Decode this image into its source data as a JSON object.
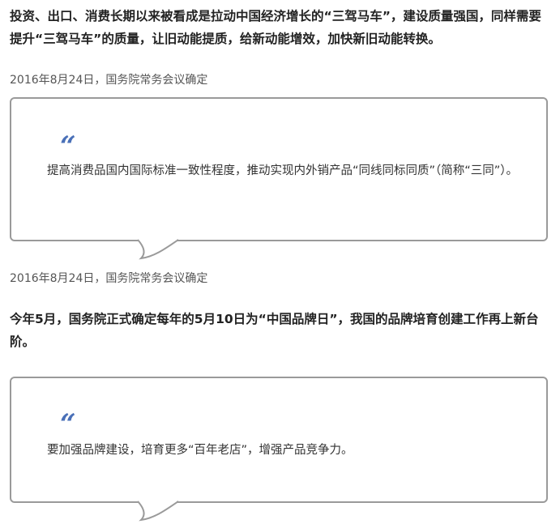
{
  "lead_1": "投资、出口、消费长期以来被看成是拉动中国经济增长的“三驾马车”，建设质量强国，同样需要提升“三驾马车”的质量，让旧动能提质，给新动能增效，加快新旧动能转换。",
  "date_1": "2016年8月24日，国务院常务会议确定",
  "quote_1": {
    "mark": "“",
    "text": "提高消费品国内国际标准一致性程度，推动实现内外销产品“同线同标同质”（简称“三同”）。"
  },
  "date_2": "2016年8月24日，国务院常务会议确定",
  "lead_2": "今年5月，国务院正式确定每年的5月10日为“中国品牌日”，我国的品牌培育创建工作再上新台阶。",
  "quote_2": {
    "mark": "“",
    "text": "要加强品牌建设，培育更多“百年老店”，增强产品竞争力。"
  },
  "colors": {
    "accent": "#4a70b8",
    "border": "#9a9a9a"
  }
}
